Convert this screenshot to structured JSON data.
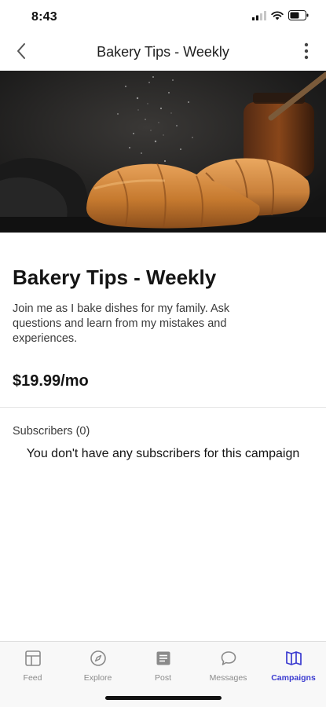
{
  "status": {
    "time": "8:43"
  },
  "nav": {
    "title": "Bakery Tips - Weekly"
  },
  "campaign": {
    "title": "Bakery Tips - Weekly",
    "description": "Join me as I bake dishes for my family. Ask questions and learn from my mistakes and experiences.",
    "price": "$19.99/mo"
  },
  "subscribers": {
    "label": "Subscribers (0)",
    "empty_message": "You don't have any subscribers for this campaign"
  },
  "tabs": [
    {
      "label": "Feed",
      "icon": "feed-icon",
      "active": false
    },
    {
      "label": "Explore",
      "icon": "compass-icon",
      "active": false
    },
    {
      "label": "Post",
      "icon": "post-icon",
      "active": false
    },
    {
      "label": "Messages",
      "icon": "chat-bubble-icon",
      "active": false
    },
    {
      "label": "Campaigns",
      "icon": "campaigns-icon",
      "active": true
    }
  ],
  "colors": {
    "accent": "#3b3bd0",
    "inactive": "#8a8a8a",
    "text": "#141414"
  }
}
